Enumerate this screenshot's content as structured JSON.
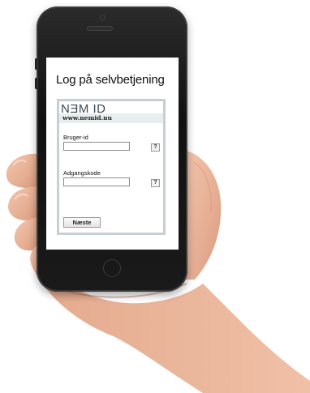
{
  "screen": {
    "title": "Log på selvbetjening"
  },
  "nemid": {
    "logo": "NƎM ID",
    "url": "www.nemid.nu",
    "user_label": "Bruger-id",
    "user_value": "",
    "user_help": "?",
    "password_label": "Adgangskode",
    "password_value": "",
    "password_help": "?",
    "next_label": "Næste"
  },
  "colors": {
    "phone_body": "#1a1a1a",
    "skin": "#e9b59c",
    "nemid_border": "#c5cfd4"
  }
}
